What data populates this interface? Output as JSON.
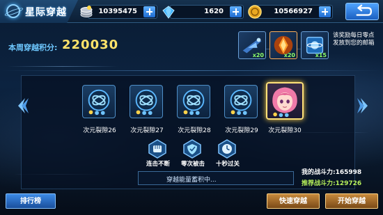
{
  "header": {
    "title": "星际穿越",
    "resources": [
      {
        "icon": "coin-stack-icon",
        "value": "10395475"
      },
      {
        "icon": "diamond-icon",
        "value": "1620"
      },
      {
        "icon": "gold-coin-icon",
        "value": "10566927"
      }
    ]
  },
  "score": {
    "label": "本周穿越积分:",
    "value": "220030"
  },
  "rewards": {
    "items": [
      {
        "icon": "starship-icon",
        "count": "x20"
      },
      {
        "icon": "energy-crystal-icon",
        "count": "x20"
      },
      {
        "icon": "planet-chip-icon",
        "count": "x15"
      }
    ],
    "note": "该奖励每日零点发放到您的邮箱"
  },
  "stages": [
    {
      "label": "次元裂隙26",
      "icon": "rift-portal-icon"
    },
    {
      "label": "次元裂隙27",
      "icon": "rift-portal-icon"
    },
    {
      "label": "次元裂隙28",
      "icon": "rift-portal-icon"
    },
    {
      "label": "次元裂隙29",
      "icon": "rift-portal-icon"
    },
    {
      "label": "次元裂隙30",
      "icon": "boss-portrait-icon"
    }
  ],
  "achievements": [
    {
      "label": "连击不断",
      "icon": "fist-icon"
    },
    {
      "label": "零次被击",
      "icon": "shield-icon"
    },
    {
      "label": "十秒过关",
      "icon": "clock-icon"
    }
  ],
  "status": {
    "text": "穿越能量蓄积中..."
  },
  "power": {
    "mine_label": "我的战斗力:",
    "mine_value": "165998",
    "recommended_label": "推荐战斗力:",
    "recommended_value": "129726"
  },
  "buttons": {
    "ranking": "排行榜",
    "quick": "快速穿越",
    "start": "开始穿越"
  },
  "colors": {
    "accent_blue": "#4fa3ff",
    "score_yellow": "#ffe36a",
    "active_border": "#ffe27a",
    "recommended_green": "#b6f05a"
  }
}
